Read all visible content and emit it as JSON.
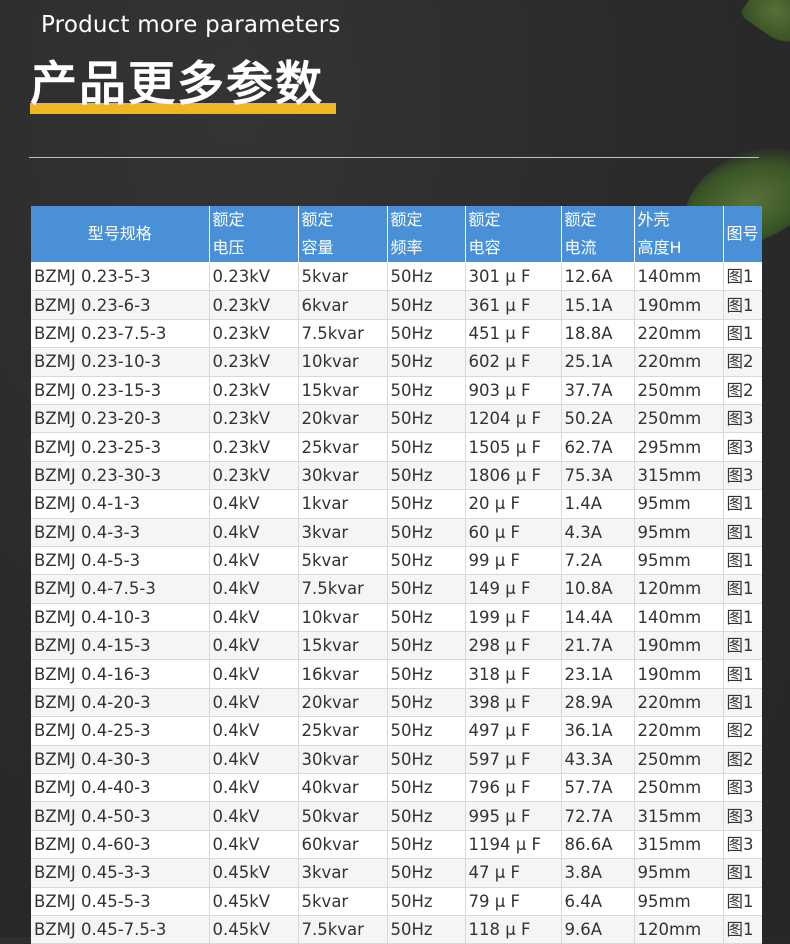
{
  "header": {
    "subtitle_en": "Product more parameters",
    "title_cn": "产品更多参数",
    "accent_color": "#f2b622"
  },
  "table": {
    "header_color": "#4a90d6",
    "columns": [
      {
        "line1": "型号规格",
        "line2": ""
      },
      {
        "line1": "额定",
        "line2": "电压"
      },
      {
        "line1": "额定",
        "line2": "容量"
      },
      {
        "line1": "额定",
        "line2": "频率"
      },
      {
        "line1": "额定",
        "line2": "电容"
      },
      {
        "line1": "额定",
        "line2": "电流"
      },
      {
        "line1": "外壳",
        "line2": "高度H"
      },
      {
        "line1": "图号",
        "line2": ""
      }
    ],
    "rows": [
      [
        "BZMJ 0.23-5-3",
        "0.23kV",
        "5kvar",
        "50Hz",
        "301 μ F",
        "12.6A",
        "140mm",
        "图1"
      ],
      [
        "BZMJ 0.23-6-3",
        "0.23kV",
        "6kvar",
        "50Hz",
        "361 μ F",
        "15.1A",
        "190mm",
        "图1"
      ],
      [
        "BZMJ 0.23-7.5-3",
        "0.23kV",
        "7.5kvar",
        "50Hz",
        "451 μ F",
        "18.8A",
        "220mm",
        "图1"
      ],
      [
        "BZMJ 0.23-10-3",
        "0.23kV",
        "10kvar",
        "50Hz",
        "602 μ F",
        "25.1A",
        "220mm",
        "图2"
      ],
      [
        "BZMJ 0.23-15-3",
        "0.23kV",
        "15kvar",
        "50Hz",
        "903 μ F",
        "37.7A",
        "250mm",
        "图2"
      ],
      [
        "BZMJ 0.23-20-3",
        "0.23kV",
        "20kvar",
        "50Hz",
        "1204 μ F",
        "50.2A",
        "250mm",
        "图3"
      ],
      [
        "BZMJ 0.23-25-3",
        "0.23kV",
        "25kvar",
        "50Hz",
        "1505 μ F",
        "62.7A",
        "295mm",
        "图3"
      ],
      [
        "BZMJ 0.23-30-3",
        "0.23kV",
        "30kvar",
        "50Hz",
        "1806 μ F",
        "75.3A",
        "315mm",
        "图3"
      ],
      [
        "BZMJ 0.4-1-3",
        "0.4kV",
        "1kvar",
        "50Hz",
        "20 μ F",
        "1.4A",
        "95mm",
        "图1"
      ],
      [
        "BZMJ 0.4-3-3",
        "0.4kV",
        "3kvar",
        "50Hz",
        "60 μ F",
        "4.3A",
        "95mm",
        "图1"
      ],
      [
        "BZMJ 0.4-5-3",
        "0.4kV",
        "5kvar",
        "50Hz",
        "99 μ F",
        "7.2A",
        "95mm",
        "图1"
      ],
      [
        "BZMJ 0.4-7.5-3",
        "0.4kV",
        "7.5kvar",
        "50Hz",
        "149 μ F",
        "10.8A",
        "120mm",
        "图1"
      ],
      [
        "BZMJ 0.4-10-3",
        "0.4kV",
        "10kvar",
        "50Hz",
        "199 μ F",
        "14.4A",
        "140mm",
        "图1"
      ],
      [
        "BZMJ 0.4-15-3",
        "0.4kV",
        "15kvar",
        "50Hz",
        "298 μ F",
        "21.7A",
        "190mm",
        "图1"
      ],
      [
        "BZMJ 0.4-16-3",
        "0.4kV",
        "16kvar",
        "50Hz",
        "318 μ F",
        "23.1A",
        "190mm",
        "图1"
      ],
      [
        "BZMJ 0.4-20-3",
        "0.4kV",
        "20kvar",
        "50Hz",
        "398 μ F",
        "28.9A",
        "220mm",
        "图1"
      ],
      [
        "BZMJ 0.4-25-3",
        "0.4kV",
        "25kvar",
        "50Hz",
        "497 μ F",
        "36.1A",
        "220mm",
        "图2"
      ],
      [
        "BZMJ 0.4-30-3",
        "0.4kV",
        "30kvar",
        "50Hz",
        "597 μ F",
        "43.3A",
        "250mm",
        "图2"
      ],
      [
        "BZMJ 0.4-40-3",
        "0.4kV",
        "40kvar",
        "50Hz",
        "796 μ F",
        "57.7A",
        "250mm",
        "图3"
      ],
      [
        "BZMJ 0.4-50-3",
        "0.4kV",
        "50kvar",
        "50Hz",
        "995 μ F",
        "72.7A",
        "315mm",
        "图3"
      ],
      [
        "BZMJ 0.4-60-3",
        "0.4kV",
        "60kvar",
        "50Hz",
        "1194 μ F",
        "86.6A",
        "315mm",
        "图3"
      ],
      [
        "BZMJ 0.45-3-3",
        "0.45kV",
        "3kvar",
        "50Hz",
        "47 μ F",
        "3.8A",
        "95mm",
        "图1"
      ],
      [
        "BZMJ 0.45-5-3",
        "0.45kV",
        "5kvar",
        "50Hz",
        "79 μ F",
        "6.4A",
        "95mm",
        "图1"
      ],
      [
        "BZMJ 0.45-7.5-3",
        "0.45kV",
        "7.5kvar",
        "50Hz",
        "118 μ F",
        "9.6A",
        "120mm",
        "图1"
      ]
    ]
  }
}
